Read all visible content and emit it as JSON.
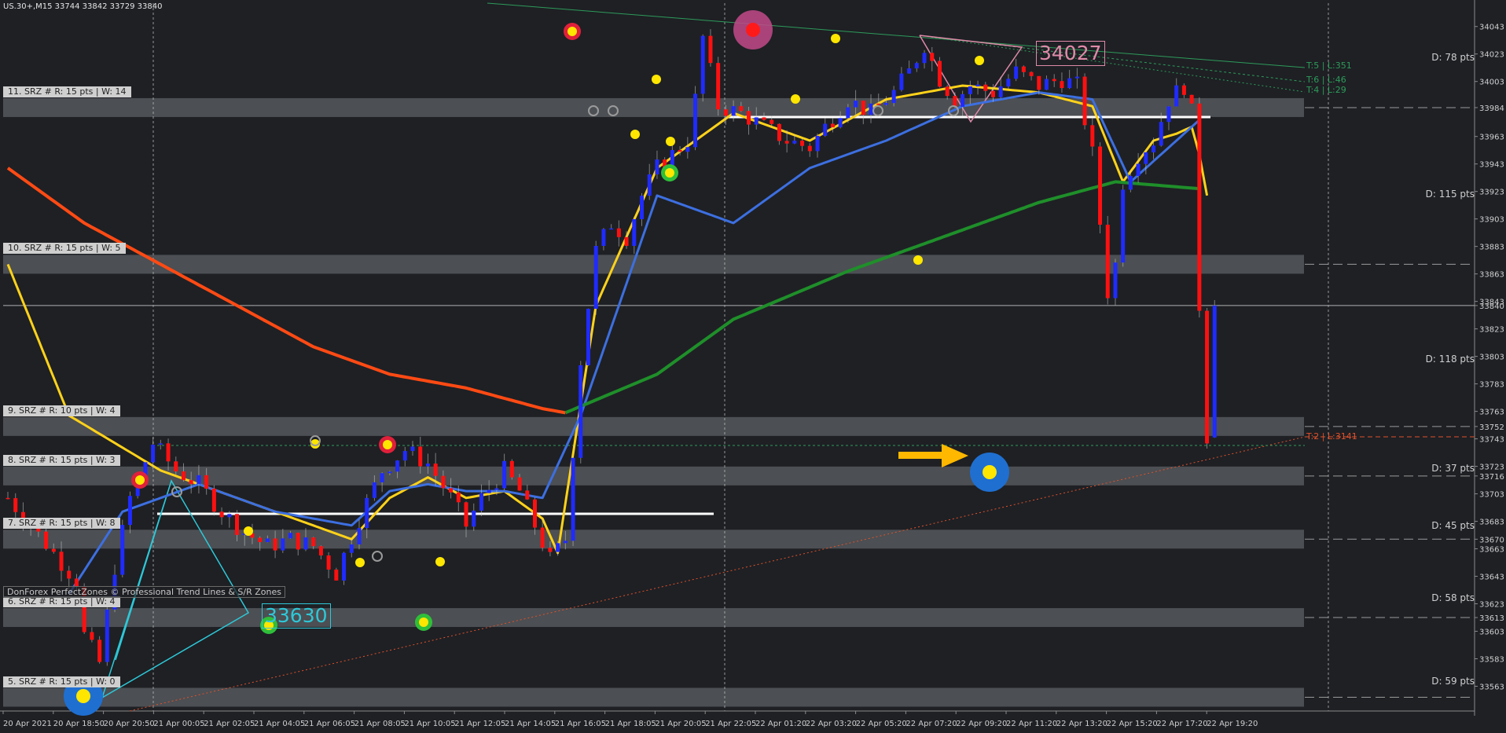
{
  "header": {
    "symbol_info": "US.30+,M15  33744 33842 33729 33840"
  },
  "credit_text": "DonForex PerfectZones © Professional Trend Lines & S/R Zones",
  "callouts": {
    "high_value": "34027",
    "low_value": "33630"
  },
  "zones": [
    {
      "label": "11. SRZ # R: 15 pts | W: 14",
      "price": 33984
    },
    {
      "label": "10. SRZ # R: 15 pts | W: 5",
      "price": 33870
    },
    {
      "label": "9. SRZ # R: 10 pts | W: 4",
      "price": 33752
    },
    {
      "label": "8. SRZ # R: 15 pts | W: 3",
      "price": 33716
    },
    {
      "label": "7. SRZ # R: 15 pts | W: 8",
      "price": 33670
    },
    {
      "label": "6. SRZ # R: 15 pts | W: 4",
      "price": 33613
    },
    {
      "label": "5. SRZ # R: 15 pts | W: 0",
      "price": 33555
    }
  ],
  "distance_labels": [
    "D: 78 pts",
    "D: 115 pts",
    "D: 118 pts",
    "D: 37 pts",
    "D: 45 pts",
    "D: 58 pts",
    "D: 59 pts"
  ],
  "trend_labels": [
    {
      "text": "T:5 | L:351",
      "color": "#2e9b5a"
    },
    {
      "text": "T:6 | L:46",
      "color": "#2e9b5a"
    },
    {
      "text": "T:4 | L:29",
      "color": "#2e9b5a"
    },
    {
      "text": "T:2 | L:3141",
      "color": "#e0502a"
    }
  ],
  "colors": {
    "background": "#1e2024",
    "bull_candle": "#1f2bff",
    "bear_candle": "#ff1010",
    "ma_fast": "#ffd21a",
    "ma_mid": "#3d6fe0",
    "ma_slow_red": "#ff4a14",
    "ma_slow_green": "#1f8f2a",
    "zone_band": "#5c5f63",
    "accent_arrow": "#ffb800"
  },
  "chart_data": {
    "type": "candlestick",
    "title": "US.30+,M15",
    "ohlc_last": {
      "open": 33744,
      "high": 33842,
      "low": 33729,
      "close": 33840
    },
    "ylim": [
      33545,
      34060
    ],
    "y_ticks": [
      34043,
      34023,
      34003,
      33984,
      33963,
      33943,
      33923,
      33903,
      33883,
      33863,
      33843,
      33840,
      33823,
      33803,
      33783,
      33763,
      33752,
      33743,
      33723,
      33716,
      33703,
      33683,
      33670,
      33663,
      33643,
      33623,
      33613,
      33603,
      33583,
      33563
    ],
    "x_tick_labels": [
      "20 Apr 2021",
      "20 Apr 18:50",
      "20 Apr 20:50",
      "21 Apr 00:05",
      "21 Apr 02:05",
      "21 Apr 04:05",
      "21 Apr 06:05",
      "21 Apr 08:05",
      "21 Apr 10:05",
      "21 Apr 12:05",
      "21 Apr 14:05",
      "21 Apr 16:05",
      "21 Apr 18:05",
      "21 Apr 20:05",
      "21 Apr 22:05",
      "22 Apr 01:20",
      "22 Apr 03:20",
      "22 Apr 05:20",
      "22 Apr 07:20",
      "22 Apr 09:20",
      "22 Apr 11:20",
      "22 Apr 13:20",
      "22 Apr 15:20",
      "22 Apr 17:20",
      "22 Apr 19:20"
    ],
    "price_anchors": [
      [
        0,
        33700
      ],
      [
        3,
        33680
      ],
      [
        6,
        33660
      ],
      [
        9,
        33640
      ],
      [
        10,
        33600
      ],
      [
        12,
        33580
      ],
      [
        14,
        33650
      ],
      [
        16,
        33700
      ],
      [
        19,
        33740
      ],
      [
        22,
        33720
      ],
      [
        25,
        33710
      ],
      [
        28,
        33690
      ],
      [
        31,
        33675
      ],
      [
        34,
        33665
      ],
      [
        37,
        33670
      ],
      [
        40,
        33665
      ],
      [
        43,
        33645
      ],
      [
        46,
        33685
      ],
      [
        49,
        33720
      ],
      [
        52,
        33735
      ],
      [
        55,
        33725
      ],
      [
        58,
        33700
      ],
      [
        60,
        33680
      ],
      [
        62,
        33700
      ],
      [
        65,
        33720
      ],
      [
        67,
        33705
      ],
      [
        69,
        33680
      ],
      [
        71,
        33655
      ],
      [
        73,
        33670
      ],
      [
        75,
        33800
      ],
      [
        77,
        33880
      ],
      [
        79,
        33900
      ],
      [
        81,
        33890
      ],
      [
        83,
        33920
      ],
      [
        85,
        33940
      ],
      [
        87,
        33950
      ],
      [
        89,
        33960
      ],
      [
        90,
        33990
      ],
      [
        91,
        34035
      ],
      [
        93,
        33985
      ],
      [
        96,
        33980
      ],
      [
        99,
        33970
      ],
      [
        102,
        33960
      ],
      [
        105,
        33955
      ],
      [
        107,
        33970
      ],
      [
        110,
        33990
      ],
      [
        113,
        33980
      ],
      [
        116,
        33995
      ],
      [
        118,
        34010
      ],
      [
        120,
        34030
      ],
      [
        122,
        34005
      ],
      [
        124,
        33990
      ],
      [
        126,
        34000
      ],
      [
        129,
        33995
      ],
      [
        132,
        34010
      ],
      [
        135,
        34000
      ],
      [
        138,
        34005
      ],
      [
        140,
        34000
      ],
      [
        142,
        33950
      ],
      [
        143,
        33900
      ],
      [
        144,
        33850
      ],
      [
        145,
        33870
      ],
      [
        146,
        33930
      ],
      [
        148,
        33950
      ],
      [
        150,
        33960
      ],
      [
        152,
        33990
      ],
      [
        154,
        34000
      ],
      [
        155,
        33980
      ],
      [
        156,
        33840
      ],
      [
        157,
        33745
      ],
      [
        158,
        33840
      ]
    ],
    "series": [
      {
        "name": "",
        "kind": "ma",
        "color": "#ffd21a",
        "points": [
          [
            0,
            33870
          ],
          [
            8,
            33760
          ],
          [
            20,
            33720
          ],
          [
            35,
            33690
          ],
          [
            45,
            33670
          ],
          [
            50,
            33700
          ],
          [
            55,
            33715
          ],
          [
            60,
            33700
          ],
          [
            65,
            33705
          ],
          [
            70,
            33685
          ],
          [
            72,
            33660
          ],
          [
            77,
            33840
          ],
          [
            85,
            33940
          ],
          [
            95,
            33980
          ],
          [
            105,
            33960
          ],
          [
            115,
            33990
          ],
          [
            125,
            34000
          ],
          [
            135,
            33995
          ],
          [
            142,
            33985
          ],
          [
            146,
            33930
          ],
          [
            150,
            33960
          ],
          [
            153,
            33965
          ],
          [
            155,
            33970
          ],
          [
            156,
            33950
          ],
          [
            157,
            33920
          ]
        ]
      },
      {
        "name": "",
        "kind": "ma",
        "color": "#3d6fe0",
        "points": [
          [
            8,
            33630
          ],
          [
            15,
            33690
          ],
          [
            25,
            33710
          ],
          [
            35,
            33690
          ],
          [
            45,
            33680
          ],
          [
            50,
            33705
          ],
          [
            55,
            33710
          ],
          [
            60,
            33705
          ],
          [
            65,
            33705
          ],
          [
            70,
            33700
          ],
          [
            75,
            33760
          ],
          [
            85,
            33920
          ],
          [
            95,
            33900
          ],
          [
            105,
            33940
          ],
          [
            115,
            33960
          ],
          [
            125,
            33985
          ],
          [
            135,
            33995
          ],
          [
            142,
            33990
          ],
          [
            147,
            33930
          ],
          [
            152,
            33955
          ],
          [
            156,
            33975
          ]
        ]
      },
      {
        "name": "",
        "kind": "ma",
        "color": "#ff4a14",
        "points": [
          [
            0,
            33940
          ],
          [
            10,
            33900
          ],
          [
            20,
            33870
          ],
          [
            30,
            33840
          ],
          [
            40,
            33810
          ],
          [
            50,
            33790
          ],
          [
            60,
            33780
          ],
          [
            70,
            33765
          ],
          [
            73,
            33762
          ]
        ]
      },
      {
        "name": "",
        "kind": "ma",
        "color": "#1f8f2a",
        "points": [
          [
            73,
            33762
          ],
          [
            85,
            33790
          ],
          [
            95,
            33830
          ],
          [
            110,
            33865
          ],
          [
            125,
            33895
          ],
          [
            135,
            33915
          ],
          [
            145,
            33930
          ],
          [
            156,
            33925
          ]
        ]
      }
    ],
    "grid": false,
    "legend": "none"
  }
}
